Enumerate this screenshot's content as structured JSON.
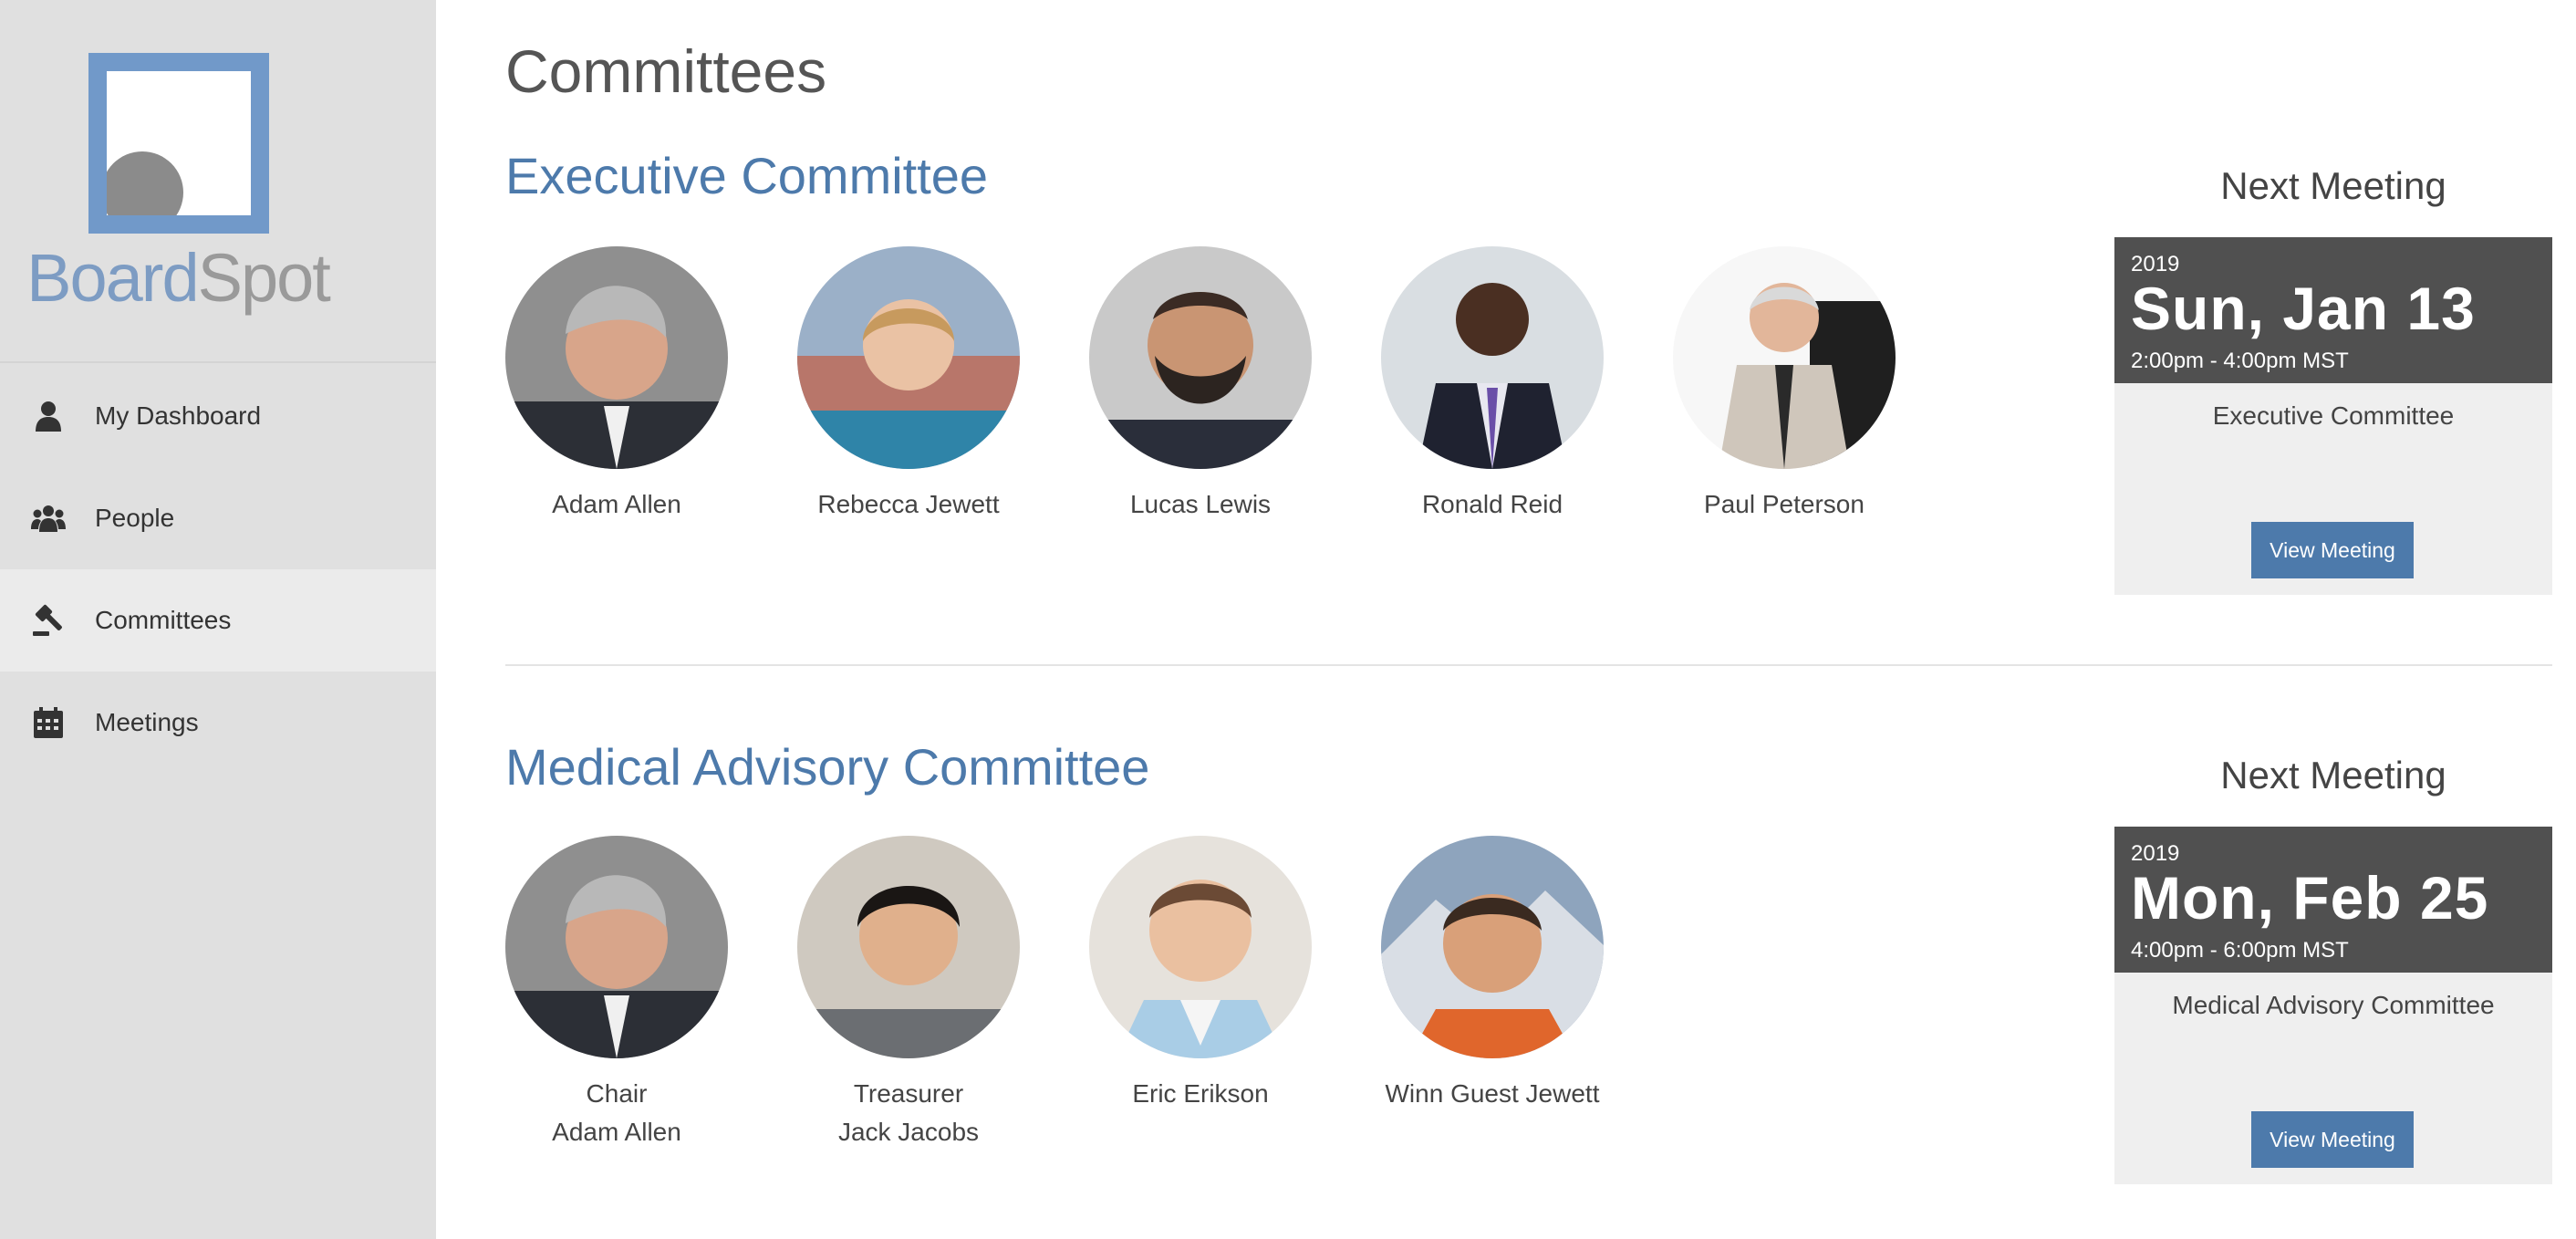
{
  "app": {
    "logo_text_board": "Board",
    "logo_text_spot": "Spot"
  },
  "sidebar": {
    "items": [
      {
        "label": "My Dashboard",
        "icon": "user-icon",
        "active": false
      },
      {
        "label": "People",
        "icon": "people-icon",
        "active": false
      },
      {
        "label": "Committees",
        "icon": "gavel-icon",
        "active": true
      },
      {
        "label": "Meetings",
        "icon": "calendar-icon",
        "active": false
      }
    ]
  },
  "main": {
    "title": "Committees",
    "committees": [
      {
        "name": "Executive Committee",
        "members": [
          {
            "role": "",
            "name": "Adam Allen"
          },
          {
            "role": "",
            "name": "Rebecca Jewett"
          },
          {
            "role": "",
            "name": "Lucas Lewis"
          },
          {
            "role": "",
            "name": "Ronald Reid"
          },
          {
            "role": "",
            "name": "Paul Peterson"
          }
        ],
        "next_meeting": {
          "heading": "Next Meeting",
          "year": "2019",
          "date": "Sun, Jan 13",
          "time": "2:00pm - 4:00pm MST",
          "committee": "Executive Committee",
          "button_label": "View Meeting"
        }
      },
      {
        "name": "Medical Advisory Committee",
        "members": [
          {
            "role": "Chair",
            "name": "Adam Allen"
          },
          {
            "role": "Treasurer",
            "name": "Jack Jacobs"
          },
          {
            "role": "",
            "name": "Eric Erikson"
          },
          {
            "role": "",
            "name": "Winn Guest Jewett"
          }
        ],
        "next_meeting": {
          "heading": "Next Meeting",
          "year": "2019",
          "date": "Mon, Feb 25",
          "time": "4:00pm - 6:00pm MST",
          "committee": "Medical Advisory Committee",
          "button_label": "View Meeting"
        }
      }
    ]
  },
  "colors": {
    "accent": "#4d7aab",
    "sidebar_bg": "#e0e0e0",
    "date_block_bg": "#505050"
  }
}
